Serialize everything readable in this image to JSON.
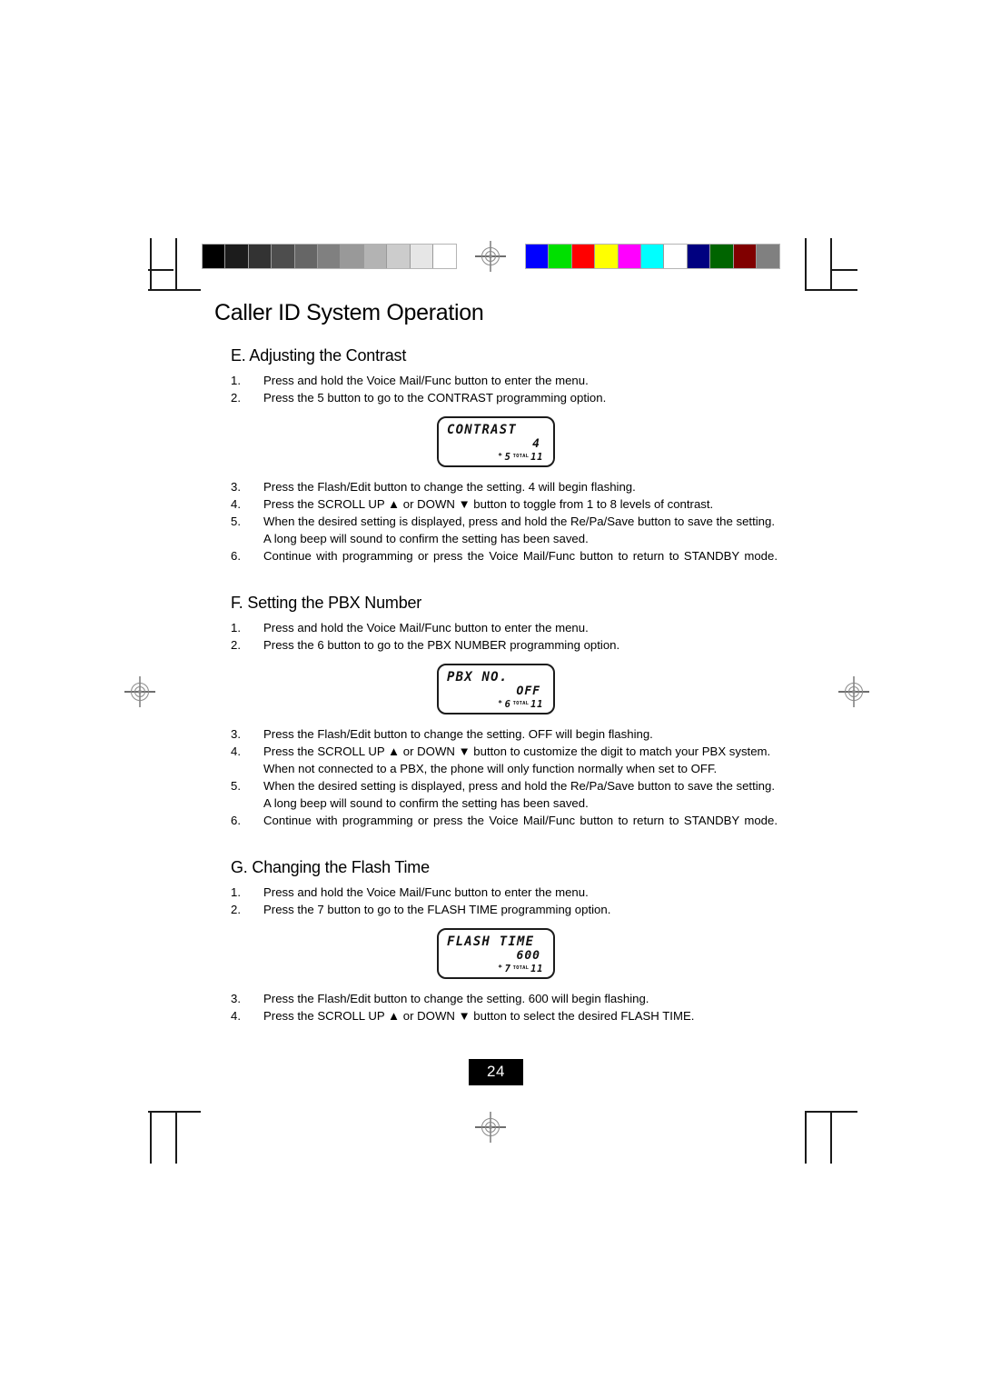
{
  "page": {
    "title": "Caller ID System Operation",
    "number": "24"
  },
  "calibration": {
    "grayscale_label": "grayscale-step-wedge",
    "grayscale_steps": [
      "#000000",
      "#1c1c1c",
      "#333333",
      "#4d4d4d",
      "#666666",
      "#808080",
      "#999999",
      "#b3b3b3",
      "#cccccc",
      "#e6e6e6",
      "#ffffff"
    ],
    "color_label": "color-control-bar",
    "color_steps": [
      "#0000ff",
      "#00e000",
      "#ff0000",
      "#ffff00",
      "#ff00ff",
      "#00ffff",
      "#ffffff",
      "#000080",
      "#006400",
      "#800000",
      "#808080"
    ]
  },
  "sections": [
    {
      "heading": "E. Adjusting the Contrast",
      "steps_before": [
        {
          "num": "1.",
          "text": "Press and hold the  Voice Mail/Func    button to enter the menu."
        },
        {
          "num": "2.",
          "text": "Press the  5  button to go to the CONTRAST programming option."
        }
      ],
      "lcd": {
        "name": "contrast-lcd",
        "line1": "CONTRAST",
        "line2": "4",
        "star": "*",
        "index": "5",
        "total_label": "TOTAL",
        "total": "11"
      },
      "steps_after": [
        {
          "num": "3.",
          "text": "Press the  Flash/Edit    button to change the setting.  4  will begin flashing."
        },
        {
          "num": "4.",
          "text": "Press the SCROLL UP ▲ or DOWN ▼ button to toggle from 1 to 8 levels of contrast."
        },
        {
          "num": "5.",
          "text": "When the desired setting is displayed, press and hold the  Re/Pa/Save  button to save the setting. A long  beep  will sound to confirm the setting has been saved."
        },
        {
          "num": "6.",
          "text": "Continue with programming or press the   Voice Mail/Func     button to return to STANDBY mode.",
          "justify": true
        }
      ]
    },
    {
      "heading": "F. Setting the PBX Number",
      "steps_before": [
        {
          "num": "1.",
          "text": "Press and hold the  Voice Mail/Func    button to enter the menu."
        },
        {
          "num": "2.",
          "text": "Press the  6  button to go to the PBX NUMBER programming option."
        }
      ],
      "lcd": {
        "name": "pbx-number-lcd",
        "line1": "PBX NO.",
        "line2": "OFF",
        "star": "*",
        "index": "6",
        "total_label": "TOTAL",
        "total": "11"
      },
      "steps_after": [
        {
          "num": "3.",
          "text": "Press the  Flash/Edit    button to change the setting.  OFF  will begin flashing."
        },
        {
          "num": "4.",
          "text": "Press the SCROLL UP ▲ or DOWN ▼ button to customize the digit to match your PBX system. When not connected to a PBX, the phone will only function normally when set to  OFF."
        },
        {
          "num": "5.",
          "text": "When the desired setting is displayed, press and hold the  Re/Pa/Save  button to save the setting. A long  beep  will sound to confirm the setting has been saved."
        },
        {
          "num": "6.",
          "text": "Continue with programming or press the   Voice Mail/Func     button to return to STANDBY mode.",
          "justify": true
        }
      ]
    },
    {
      "heading": "G. Changing the Flash Time",
      "steps_before": [
        {
          "num": "1.",
          "text": "Press and hold the  Voice Mail/Func   button to enter the menu."
        },
        {
          "num": "2.",
          "text": "Press the  7  button to go to the FLASH TIME programming option."
        }
      ],
      "lcd": {
        "name": "flash-time-lcd",
        "line1": "FLASH TIME",
        "line2": "600",
        "star": "*",
        "index": "7",
        "total_label": "TOTAL",
        "total": "11"
      },
      "steps_after": [
        {
          "num": "3.",
          "text": "Press the  Flash/Edit    button to change the setting.  600  will begin flashing."
        },
        {
          "num": "4.",
          "text": "Press the SCROLL UP ▲ or DOWN ▼ button to select the desired FLASH TIME."
        }
      ]
    }
  ]
}
